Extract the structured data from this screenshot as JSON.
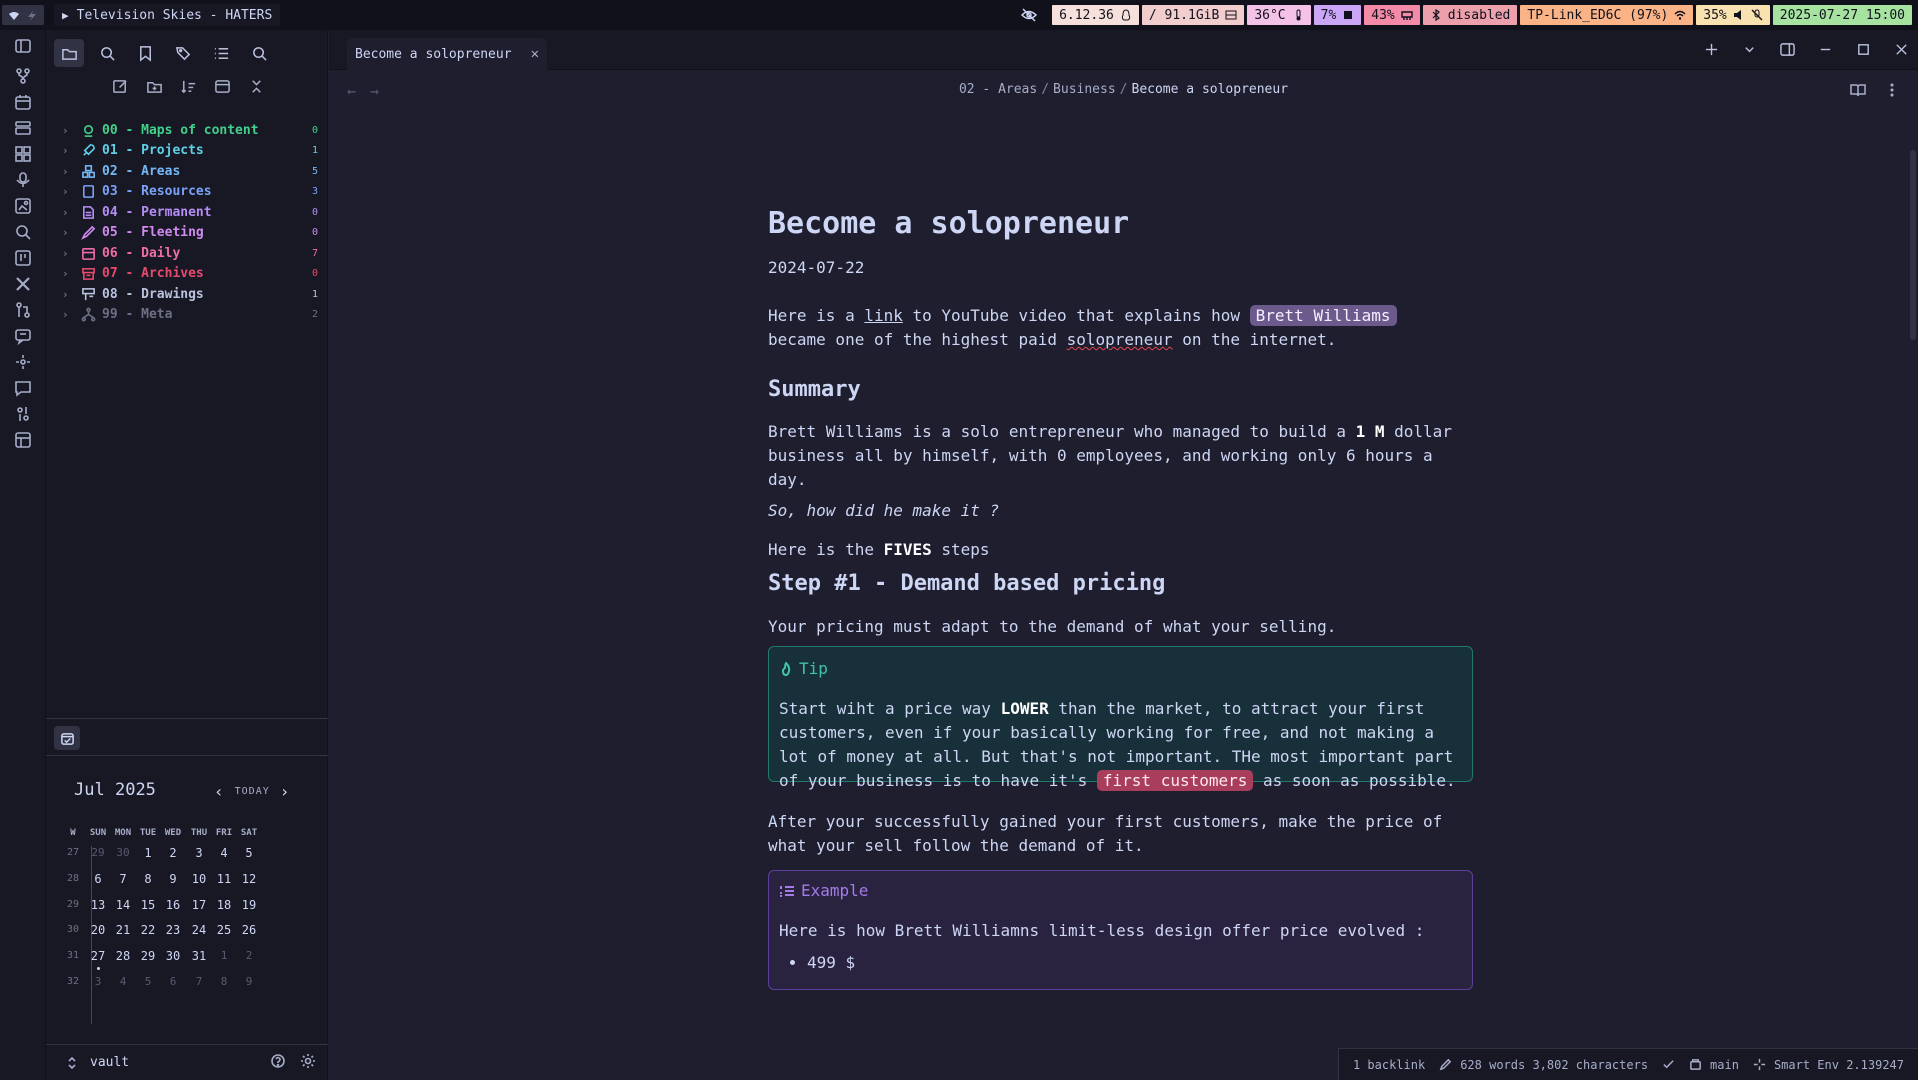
{
  "topbar": {
    "media_title": "Television Skies - HATERS",
    "kernel": "6.12.36",
    "disk": "/ 91.1GiB",
    "temp": "36°C",
    "cpu": "7%",
    "memory": "43%",
    "bluetooth": "disabled",
    "wifi": "TP-Link_ED6C (97%)",
    "volume": "35%",
    "datetime": "2025-07-27 15:00"
  },
  "sidebar": {
    "folders": [
      {
        "label": "00 - Maps of content",
        "count": "0",
        "color": "#40d08a",
        "icon": "map-pin-icon"
      },
      {
        "label": "01 - Projects",
        "count": "1",
        "color": "#5fd0e6",
        "icon": "rocket-icon"
      },
      {
        "label": "02 - Areas",
        "count": "5",
        "color": "#74b9f5",
        "icon": "boxes-icon"
      },
      {
        "label": "03 - Resources",
        "count": "3",
        "color": "#7aa2f7",
        "icon": "book-icon"
      },
      {
        "label": "04 - Permanent",
        "count": "0",
        "color": "#b48ef5",
        "icon": "document-icon"
      },
      {
        "label": "05 - Fleeting",
        "count": "0",
        "color": "#d08af0",
        "icon": "pen-icon"
      },
      {
        "label": "06 - Daily",
        "count": "7",
        "color": "#f06ca8",
        "icon": "calendar-icon"
      },
      {
        "label": "07 - Archives",
        "count": "0",
        "color": "#e64a6e",
        "icon": "archive-icon"
      },
      {
        "label": "08 - Drawings",
        "count": "1",
        "color": "#bac2de",
        "icon": "drawing-icon"
      },
      {
        "label": "99 - Meta",
        "count": "2",
        "color": "#6c7086",
        "icon": "network-icon"
      }
    ],
    "calendar": {
      "month": "Jul",
      "year": "2025",
      "today_label": "TODAY",
      "days_of_week": [
        "W",
        "SUN",
        "MON",
        "TUE",
        "WED",
        "THU",
        "FRI",
        "SAT"
      ],
      "weeks": [
        {
          "wk": "27",
          "days": [
            "29",
            "30",
            "1",
            "2",
            "3",
            "4",
            "5"
          ],
          "dim": [
            true,
            true,
            false,
            false,
            false,
            false,
            false
          ]
        },
        {
          "wk": "28",
          "days": [
            "6",
            "7",
            "8",
            "9",
            "10",
            "11",
            "12"
          ],
          "dim": [
            false,
            false,
            false,
            false,
            false,
            false,
            false
          ]
        },
        {
          "wk": "29",
          "days": [
            "13",
            "14",
            "15",
            "16",
            "17",
            "18",
            "19"
          ],
          "dim": [
            false,
            false,
            false,
            false,
            false,
            false,
            false
          ]
        },
        {
          "wk": "30",
          "days": [
            "20",
            "21",
            "22",
            "23",
            "24",
            "25",
            "26"
          ],
          "dim": [
            false,
            false,
            false,
            false,
            false,
            false,
            false
          ]
        },
        {
          "wk": "31",
          "days": [
            "27",
            "28",
            "29",
            "30",
            "31",
            "1",
            "2"
          ],
          "dim": [
            false,
            false,
            false,
            false,
            false,
            true,
            true
          ]
        },
        {
          "wk": "32",
          "days": [
            "3",
            "4",
            "5",
            "6",
            "7",
            "8",
            "9"
          ],
          "dim": [
            true,
            true,
            true,
            true,
            true,
            true,
            true
          ]
        }
      ],
      "today": "27"
    },
    "vault_name": "vault"
  },
  "tab": {
    "title": "Become a solopreneur"
  },
  "breadcrumb": {
    "part1": "02 - Areas",
    "part2": "Business",
    "current": "Become a solopreneur"
  },
  "doc": {
    "title": "Become a solopreneur",
    "date": "2024-07-22",
    "intro_1": "Here is a ",
    "intro_link": "link",
    "intro_2": " to YouTube video that explains how ",
    "intro_tag": "Brett Williams",
    "intro_3": "became one of the highest paid ",
    "intro_spell": "solopreneur",
    "intro_4": " on the internet.",
    "summary_heading": "Summary",
    "summary_1": "Brett Williams is a solo entrepreneur who managed to build a ",
    "summary_strong": "1 M",
    "summary_2": " dollar business all by himself, with 0 employees, and working only 6 hours a day.",
    "question": "So, how did he make it ?",
    "steps_1": "Here is the ",
    "steps_strong": "FIVES",
    "steps_2": " steps",
    "step1_heading": "Step #1 - Demand based pricing",
    "step1_text": "Your pricing must adapt to the demand of what your selling.",
    "tip_title": "Tip",
    "tip_1": "Start wiht a price way ",
    "tip_strong": "LOWER",
    "tip_2": " than the market, to attract your first customers, even if your basically working for free, and not making a lot of money at all. But that's not important. THe most important part of your business is to have it's ",
    "tip_tag": "first customers",
    "tip_3": " as soon as possible.",
    "after_text": "After your successfully gained your first customers, make the price of what your sell follow the demand of it.",
    "example_title": "Example",
    "example_text": "Here is how Brett Williamns limit-less design offer price evolved :",
    "example_item1": "499 $"
  },
  "statusbar": {
    "backlinks": "1 backlink",
    "words": "628 words 3,802 characters",
    "branch": "main",
    "smart_env": "Smart Env 2.139247"
  },
  "colors": {
    "kernel_bg": "#f5e0dc",
    "disk_bg": "#f2cdcd",
    "temp_bg": "#f5c2e7",
    "cpu_bg": "#cba6f7",
    "mem_bg": "#f38ba8",
    "bt_bg": "#eba0ac",
    "wifi_bg": "#fab387",
    "vol_bg": "#f9e2af",
    "clock_bg": "#a6e3a1"
  }
}
